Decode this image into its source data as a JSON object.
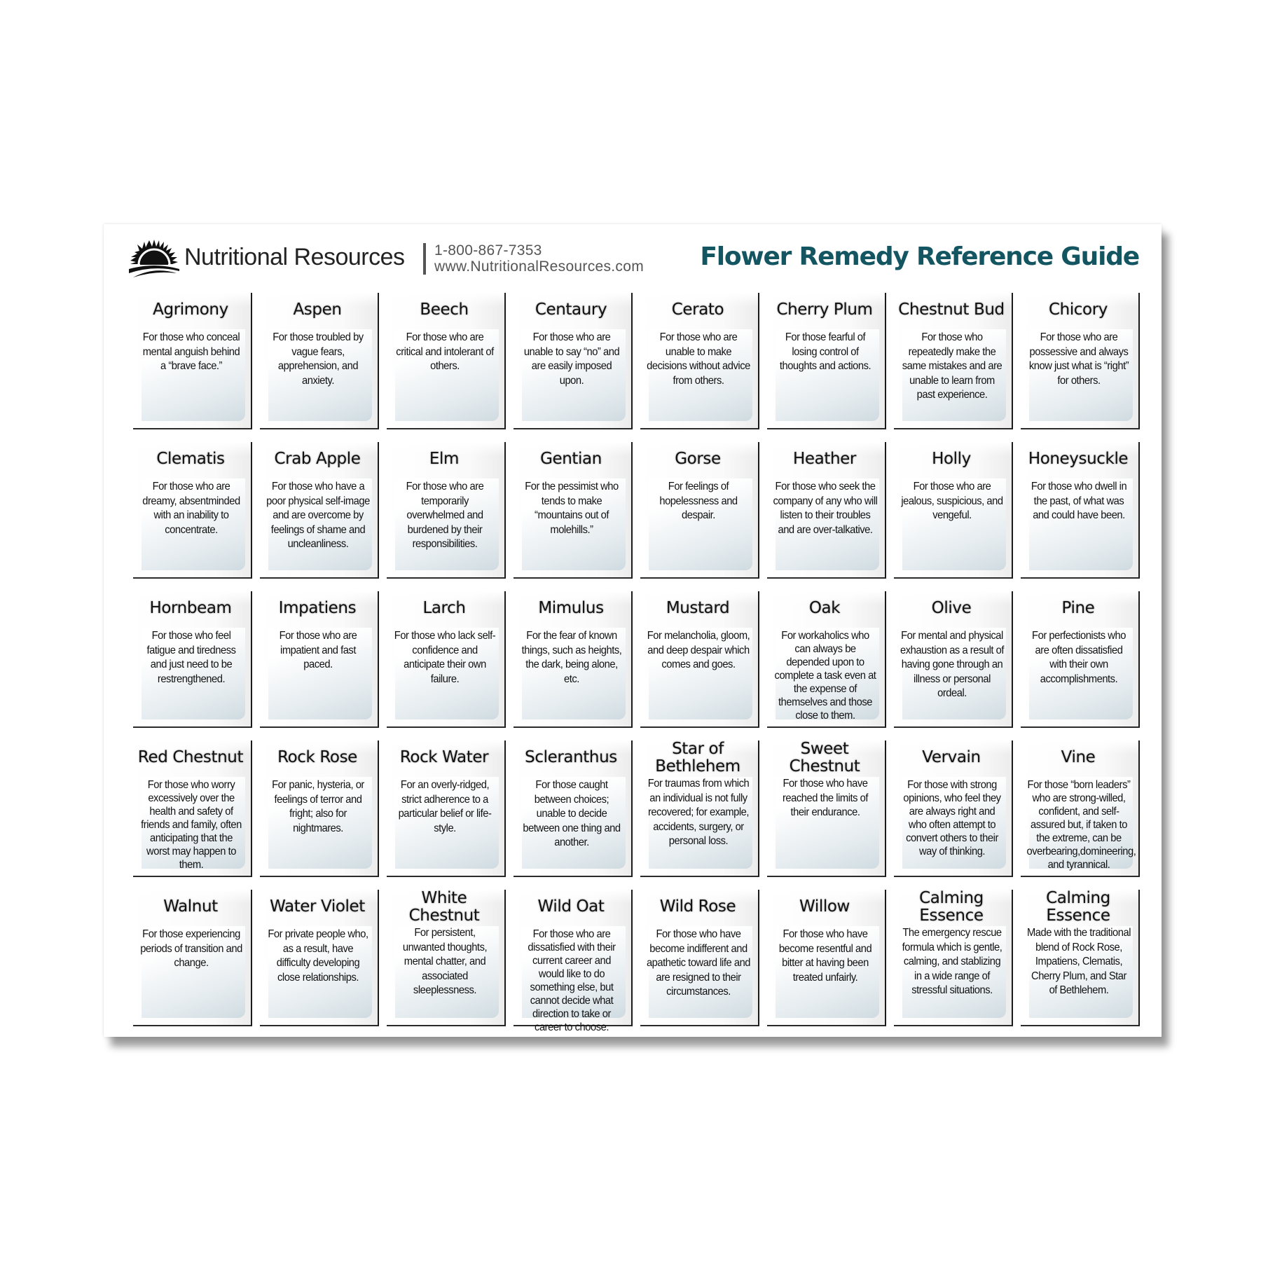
{
  "header": {
    "brand": "Nutritional Resources",
    "phone": "1-800-867-7353",
    "website": "www.NutritionalResources.com",
    "title": "Flower Remedy Reference Guide",
    "title_color": "#135560",
    "logo_icon": "sunrise-logo-icon"
  },
  "remedies": [
    {
      "name": "Agrimony",
      "description": "For those who conceal mental anguish behind a “brave face.”"
    },
    {
      "name": "Aspen",
      "description": "For those troubled by vague fears, apprehension, and anxiety."
    },
    {
      "name": "Beech",
      "description": "For those who are critical and intolerant of others."
    },
    {
      "name": "Centaury",
      "description": "For those who are unable to say “no” and are easily imposed upon."
    },
    {
      "name": "Cerato",
      "description": "For those who are unable to make decisions without advice from others."
    },
    {
      "name": "Cherry Plum",
      "description": "For those fearful of losing control of thoughts and actions."
    },
    {
      "name": "Chestnut Bud",
      "description": "For those who repeatedly make the same mistakes and are unable to learn from past experience."
    },
    {
      "name": "Chicory",
      "description": "For those who are possessive and always know just what is “right” for others."
    },
    {
      "name": "Clematis",
      "description": "For those who are dreamy, absentminded with an inability to concentrate."
    },
    {
      "name": "Crab Apple",
      "description": "For those who have a poor physical self-image and are overcome by feelings of shame and uncleanliness."
    },
    {
      "name": "Elm",
      "description": "For those who are temporarily overwhelmed and burdened by their responsibilities."
    },
    {
      "name": "Gentian",
      "description": "For the pessimist who tends to make “mountains out of molehills.”"
    },
    {
      "name": "Gorse",
      "description": "For feelings of hopelessness and despair."
    },
    {
      "name": "Heather",
      "description": "For those who seek the company of any who will listen to their troubles and are over-talkative."
    },
    {
      "name": "Holly",
      "description": "For those who are jealous, suspicious, and vengeful."
    },
    {
      "name": "Honeysuckle",
      "description": "For those who dwell in the past, of what was and could have been."
    },
    {
      "name": "Hornbeam",
      "description": "For those who feel fatigue and tiredness and just need to be restrengthened."
    },
    {
      "name": "Impatiens",
      "description": "For those who are impatient and fast paced."
    },
    {
      "name": "Larch",
      "description": "For those who lack self-confidence and anticipate their own failure."
    },
    {
      "name": "Mimulus",
      "description": "For the fear of known things, such as heights, the dark, being alone, etc."
    },
    {
      "name": "Mustard",
      "description": "For melancholia, gloom, and deep despair which comes and goes."
    },
    {
      "name": "Oak",
      "description": "For workaholics who can always be depended upon to complete a task even at the expense of themselves and those close to them."
    },
    {
      "name": "Olive",
      "description": "For mental and physical exhaustion as a result of having gone through an illness or personal ordeal."
    },
    {
      "name": "Pine",
      "description": "For perfectionists who are often dissatisfied with their own accomplishments."
    },
    {
      "name": "Red Chestnut",
      "description": "For those who worry excessively over the health and safety of friends and family, often anticipating that the worst may happen to them."
    },
    {
      "name": "Rock Rose",
      "description": "For panic, hysteria, or feelings of terror and fright; also for nightmares."
    },
    {
      "name": "Rock Water",
      "description": "For an overly-ridged, strict adherence to a particular belief or life-style."
    },
    {
      "name": "Scleranthus",
      "description": "For those caught between choices; unable to decide between one thing and another."
    },
    {
      "name": "Star of Bethlehem",
      "description": "For traumas from which an individual is not fully recovered; for example, accidents, surgery, or personal loss."
    },
    {
      "name": "Sweet Chestnut",
      "description": "For those who have reached the limits of their endurance."
    },
    {
      "name": "Vervain",
      "description": "For those with strong opinions, who feel they are always right and who often attempt to convert others to their way of thinking."
    },
    {
      "name": "Vine",
      "description": "For those “born leaders” who are strong-willed, confident, and self-assured but, if taken to the extreme, can be overbearing,domineering, and tyrannical."
    },
    {
      "name": "Walnut",
      "description": "For those experiencing periods of transition and change."
    },
    {
      "name": "Water Violet",
      "description": "For private people who, as a result, have difficulty developing close relationships."
    },
    {
      "name": "White Chestnut",
      "description": "For persistent, unwanted thoughts, mental chatter, and associated sleeplessness."
    },
    {
      "name": "Wild Oat",
      "description": "For those who are dissatisfied with their current career and would like to do something else, but cannot decide what direction to take or career to choose."
    },
    {
      "name": "Wild Rose",
      "description": "For those who have become indifferent and apathetic toward life and are resigned to their circumstances."
    },
    {
      "name": "Willow",
      "description": "For those who have become resentful and bitter at having been treated unfairly."
    },
    {
      "name": "Calming Essence",
      "description": "The emergency rescue formula which is gentle, calming, and stablizing in a wide range of stressful situations."
    },
    {
      "name": "Calming Essence",
      "description": "Made with the traditional blend of Rock Rose, Impatiens, Clematis, Cherry Plum, and Star of Bethlehem."
    }
  ]
}
